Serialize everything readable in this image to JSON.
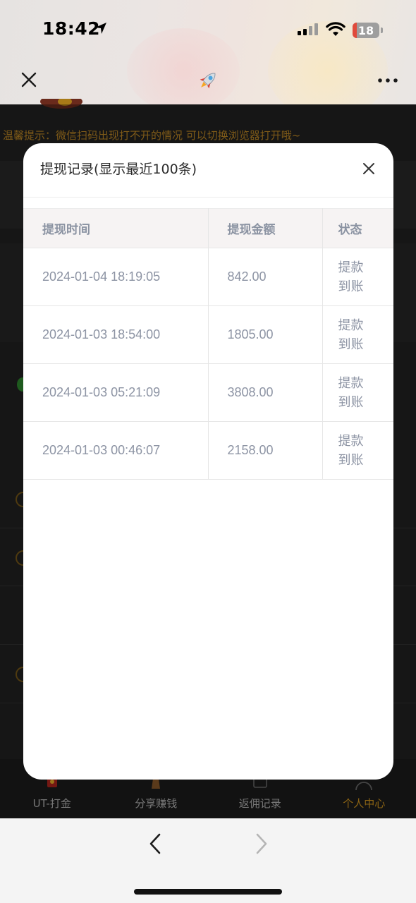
{
  "status": {
    "time": "18:42",
    "battery": "18"
  },
  "browser": {
    "close_icon": "close-icon",
    "title_icon": "rocket-icon",
    "more_icon": "more-dots-icon"
  },
  "page": {
    "notice": "温馨提示：微信扫码出现打不开的情况 可以切换浏览器打开哦~",
    "tabs": [
      {
        "label": "UT-打金",
        "icon": "gift-icon"
      },
      {
        "label": "分享赚钱",
        "icon": "bell-icon"
      },
      {
        "label": "返佣记录",
        "icon": "wallet-icon"
      },
      {
        "label": "个人中心",
        "icon": "user-icon",
        "active": true
      }
    ]
  },
  "modal": {
    "title": "提现记录(显示最近100条)",
    "headers": [
      "提现时间",
      "提现金额",
      "状态"
    ],
    "rows": [
      {
        "time": "2024-01-04 18:19:05",
        "amount": "842.00",
        "status_line1": "提款",
        "status_line2": "到账"
      },
      {
        "time": "2024-01-03 18:54:00",
        "amount": "1805.00",
        "status_line1": "提款",
        "status_line2": "到账"
      },
      {
        "time": "2024-01-03 05:21:09",
        "amount": "3808.00",
        "status_line1": "提款",
        "status_line2": "到账"
      },
      {
        "time": "2024-01-03 00:46:07",
        "amount": "2158.00",
        "status_line1": "提款",
        "status_line2": "到账"
      }
    ]
  },
  "colors": {
    "accent": "#d79a1f",
    "notice": "#c28a25",
    "table_text": "#8d94a4",
    "header_bg": "#f6f3f3"
  }
}
